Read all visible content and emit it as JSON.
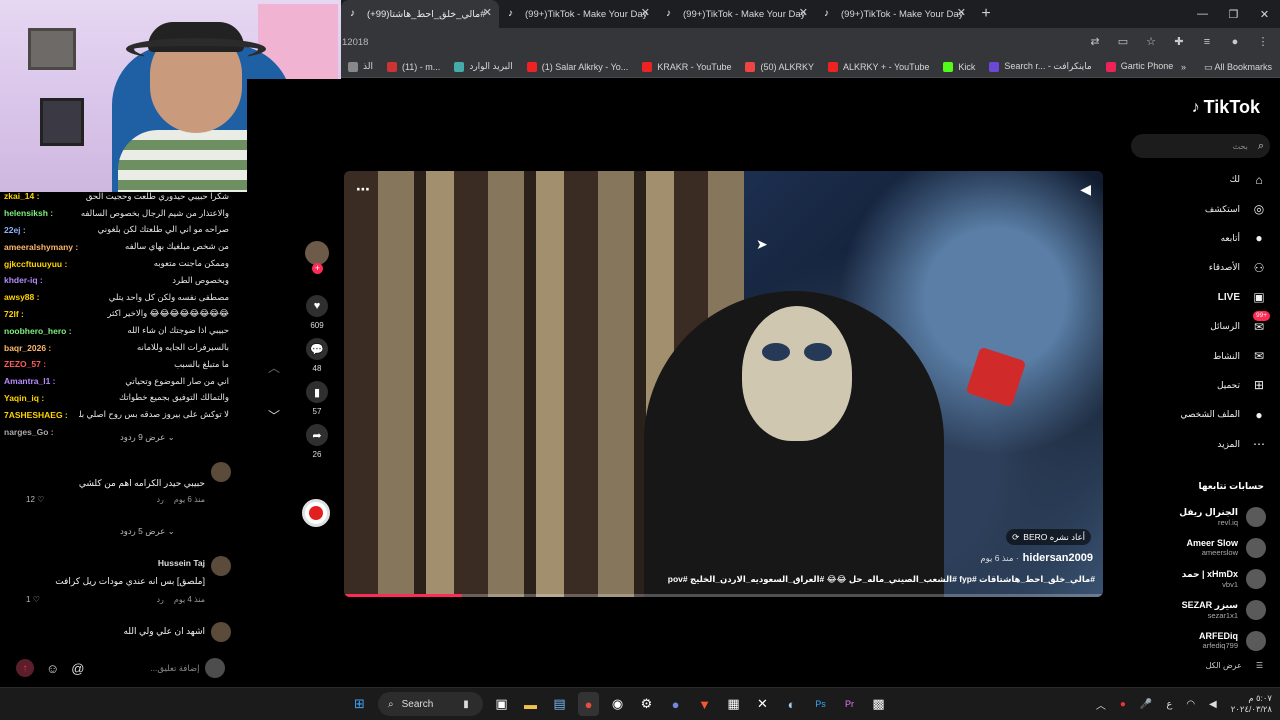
{
  "browser": {
    "tabs": [
      {
        "title": "مالي_خلق_احط_هاشتا(99+)#"
      },
      {
        "title": "(99+)TikTok - Make Your Day"
      },
      {
        "title": "(99+)TikTok - Make Your Day"
      },
      {
        "title": "(99+)TikTok - Make Your Day"
      }
    ],
    "url": "12018",
    "bookmarks": [
      {
        "label": "الذ"
      },
      {
        "label": "(11) - m..."
      },
      {
        "label": "البريد الوارد"
      },
      {
        "label": "(1) Salar Alkrky - Yo..."
      },
      {
        "label": "KRAKR - YouTube"
      },
      {
        "label": "(50) ALKRKY"
      },
      {
        "label": "ALKRKY + - YouTube"
      },
      {
        "label": "Kick"
      },
      {
        "label": "Search r... - ماينكرافت"
      },
      {
        "label": "Gartic Phone - لعبة ا..."
      }
    ],
    "all_bookmarks": "All Bookmarks"
  },
  "tiktok": {
    "logo": "TikTok",
    "search_placeholder": "بحث",
    "nav": [
      {
        "label": "لك",
        "icon": "home-icon"
      },
      {
        "label": "استكشف",
        "icon": "compass-icon"
      },
      {
        "label": "أتابعه",
        "icon": "avatar-icon"
      },
      {
        "label": "الأصدقاء",
        "icon": "friends-icon"
      },
      {
        "label": "LIVE",
        "icon": "live-icon"
      },
      {
        "label": "الرسائل",
        "icon": "messages-icon",
        "badge": "99+"
      },
      {
        "label": "النشاط",
        "icon": "activity-icon"
      },
      {
        "label": "تحميل",
        "icon": "upload-icon"
      },
      {
        "label": "الملف الشخصي",
        "icon": "profile-icon"
      },
      {
        "label": "المزيد",
        "icon": "more-icon"
      }
    ],
    "following_title": "حسابات تتابعها",
    "following": [
      {
        "name": "الجنرال ريفل",
        "handle": "revl.iq"
      },
      {
        "name": "Ameer Slow",
        "handle": "ameerslow"
      },
      {
        "name": "حمد | xHmDx",
        "handle": "vbv1"
      },
      {
        "name": "SEZAR سيزر",
        "handle": "sezar1x1"
      },
      {
        "name": "ARFEDiq",
        "handle": "arfediq799"
      }
    ],
    "see_all": "عرض الكل",
    "video": {
      "repost": "BERO أعاد نشره",
      "author": "hidersan2009",
      "date": "· منذ 6 يوم",
      "caption": "#مالي_خلق_احط_هاشتاقات #fyp #الشعب_الصيني_ماله_حل 😂😂 #العراق_السعوديه_الاردن_الخليج #pov"
    },
    "actions": {
      "likes": "609",
      "comments": "48",
      "saves": "57",
      "shares": "26"
    }
  },
  "chat": [
    {
      "user": "zkai_14 :",
      "msg": "شكرا حبيبي حيدوري طلعت وحجيت الحق"
    },
    {
      "user": "helensiksh :",
      "msg": "والاعتذار من شيم الرجال بخصوص السالفه"
    },
    {
      "user": "22ej :",
      "msg": "صراحه مو اني الي طلعتك لكن بلغوني"
    },
    {
      "user": "ameeralshymany :",
      "msg": "من شخص مبلغيك بهاي سالفه"
    },
    {
      "user": "gjkccftuuuyuu :",
      "msg": "وممكن ماجنت متعوبه"
    },
    {
      "user": "khder-iq :",
      "msg": "وبخصوص الطرد"
    },
    {
      "user": "awsy88 :",
      "msg": "مصطفى نفسه ولكن كل واحد يتلي"
    },
    {
      "user": "72lf :",
      "msg": "😂😂😂😂😂😂😂😂 والاخير اكثر"
    },
    {
      "user": "noobhero_hero :",
      "msg": "حبيبي اذا ضوجتك ان شاء الله"
    },
    {
      "user": "baqr_2026 :",
      "msg": "بالسيرفرات الجايه وللامانه"
    },
    {
      "user": "ZEZO_57 :",
      "msg": "ما متبلغ بالسبب"
    },
    {
      "user": "Amantra_I1 :",
      "msg": "اني من صار الموضوع وتحياتي"
    },
    {
      "user": "Yaqin_iq :",
      "msg": "والتمالك التوفيق بجميع خطواتك"
    },
    {
      "user": "7ASHESHAEG :",
      "msg": "لا توكش على بيروز صدقه بس روح اصلي بليز"
    },
    {
      "user": "narges_Go :",
      "msg": ""
    }
  ],
  "comments": {
    "view_replies_1": "عرض 9 ردود",
    "c1": {
      "text": "حبيبي حيدر الكرامه اهم من كلشي",
      "date": "منذ 6 يوم",
      "reply": "رد",
      "likes": "12"
    },
    "view_replies_2": "عرض 5 ردود",
    "c2": {
      "user": "Hussein Taj",
      "text": "[ملصق] بس انه عندي مودات ريل كرافت",
      "date": "منذ 4 يوم",
      "reply": "رد",
      "likes": "1"
    },
    "c3": {
      "text": "اشهد ان علي ولي الله"
    },
    "input_placeholder": "إضافة تعليق..."
  },
  "taskbar": {
    "search": "Search",
    "lang": "ع",
    "time": "٥:٠٧ م",
    "date": "٢٠٢٤/٠٣/٢٨"
  }
}
